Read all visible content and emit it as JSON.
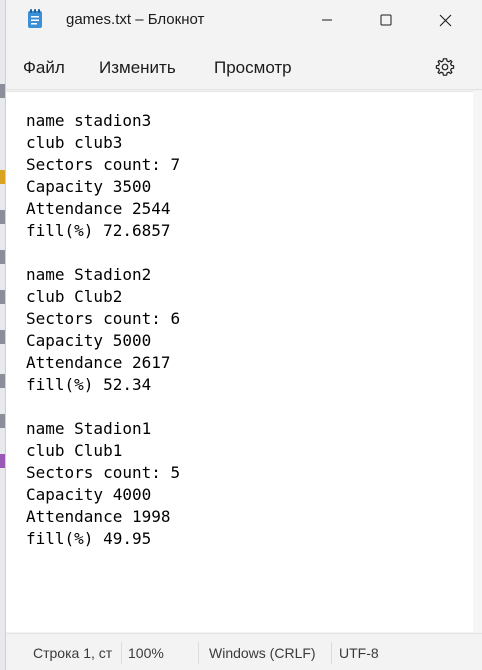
{
  "window": {
    "title": "games.txt – Блокнот"
  },
  "menu": {
    "file": "Файл",
    "edit": "Изменить",
    "view": "Просмотр"
  },
  "editor": {
    "lines": [
      "name stadion3",
      "club club3",
      "Sectors count: 7",
      "Capacity 3500",
      "Attendance 2544",
      "fill(%) 72.6857",
      "",
      "name Stadion2",
      "club Club2",
      "Sectors count: 6",
      "Capacity 5000",
      "Attendance 2617",
      "fill(%) 52.34",
      "",
      "name Stadion1",
      "club Club1",
      "Sectors count: 5",
      "Capacity 4000",
      "Attendance 1998",
      "fill(%) 49.95"
    ]
  },
  "status": {
    "position": "Строка 1, ст",
    "zoom": "100%",
    "line_ending": "Windows (CRLF)",
    "encoding": "UTF-8"
  },
  "icons": {
    "app": "notepad-icon",
    "minimize": "minimize-icon",
    "maximize": "maximize-icon",
    "close": "close-icon",
    "settings": "gear-icon"
  },
  "colors": {
    "chrome": "#f3f3f3",
    "editor_bg": "#ffffff",
    "text": "#000000",
    "app_icon": "#3a8fd6"
  }
}
